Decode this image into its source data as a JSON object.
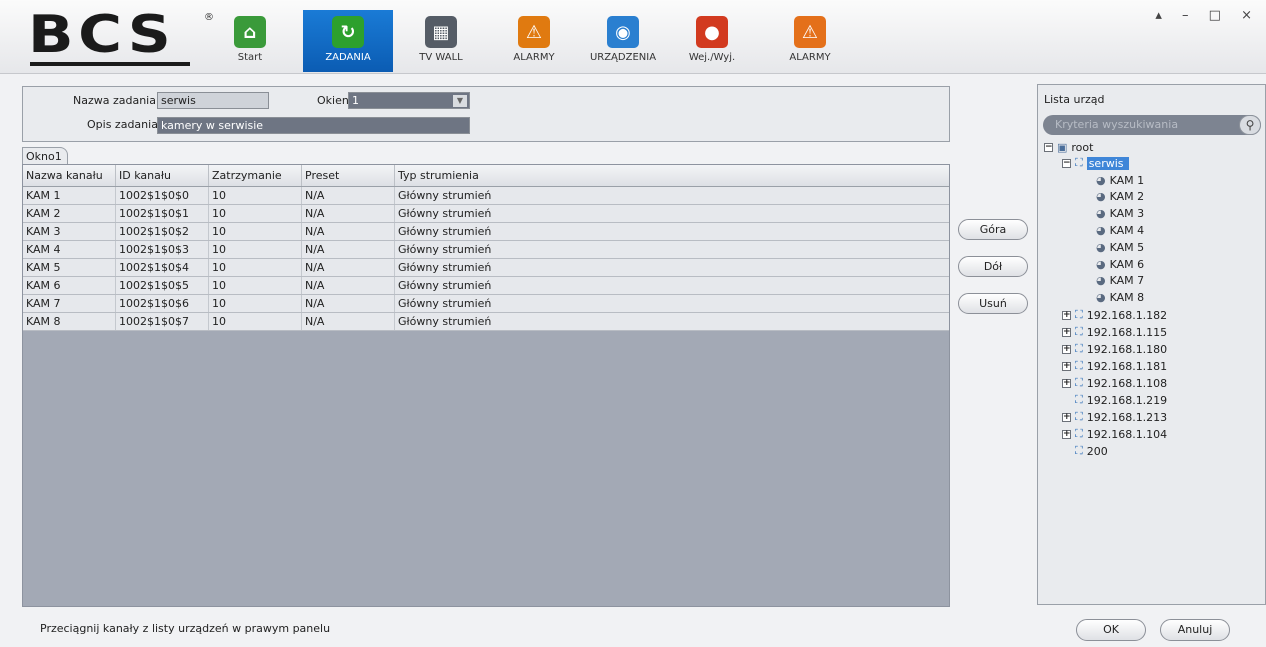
{
  "logo": {
    "text": "BCS",
    "reg": "®"
  },
  "nav": [
    {
      "label": "Start",
      "icon": "home-icon",
      "color": "#3a9a3a",
      "active": false
    },
    {
      "label": "ZADANIA",
      "icon": "tasks-icon",
      "color": "#2da02d",
      "active": true
    },
    {
      "label": "TV WALL",
      "icon": "tv-wall-icon",
      "color": "#555c66",
      "active": false
    },
    {
      "label": "ALARMY",
      "icon": "alarm-warning-icon",
      "color": "#e07a10",
      "active": false
    },
    {
      "label": "URZĄDZENIA",
      "icon": "device-icon",
      "color": "#2a7fd0",
      "active": false
    },
    {
      "label": "Wej./Wyj.",
      "icon": "siren-icon",
      "color": "#d23a1f",
      "active": false
    },
    {
      "label": "ALARMY",
      "icon": "alarm-icon",
      "color": "#e4701a",
      "active": false
    }
  ],
  "window_controls": "▴ – □ ×",
  "form": {
    "task_name_label": "Nazwa zadania",
    "task_name_value": "serwis",
    "windows_label": "Okien",
    "windows_value": "1",
    "task_desc_label": "Opis zadania",
    "task_desc_value": "kamery w serwisie"
  },
  "tab_label": "Okno1",
  "table": {
    "headers": [
      "Nazwa kanału",
      "ID kanału",
      "Zatrzymanie",
      "Preset",
      "Typ strumienia"
    ],
    "rows": [
      [
        "KAM 1",
        "1002$1$0$0",
        "10",
        "N/A",
        "Główny strumień"
      ],
      [
        "KAM 2",
        "1002$1$0$1",
        "10",
        "N/A",
        "Główny strumień"
      ],
      [
        "KAM 3",
        "1002$1$0$2",
        "10",
        "N/A",
        "Główny strumień"
      ],
      [
        "KAM 4",
        "1002$1$0$3",
        "10",
        "N/A",
        "Główny strumień"
      ],
      [
        "KAM 5",
        "1002$1$0$4",
        "10",
        "N/A",
        "Główny strumień"
      ],
      [
        "KAM 6",
        "1002$1$0$5",
        "10",
        "N/A",
        "Główny strumień"
      ],
      [
        "KAM 7",
        "1002$1$0$6",
        "10",
        "N/A",
        "Główny strumień"
      ],
      [
        "KAM 8",
        "1002$1$0$7",
        "10",
        "N/A",
        "Główny strumień"
      ]
    ]
  },
  "side_buttons": {
    "up": "Góra",
    "down": "Dół",
    "remove": "Usuń"
  },
  "footnote": "Przeciągnij kanały z listy urządzeń w prawym panelu",
  "device_panel": {
    "title": "Lista urząd",
    "search_placeholder": "Kryteria wyszukiwania",
    "root": "root",
    "group": "serwis",
    "cameras": [
      "KAM 1",
      "KAM 2",
      "KAM 3",
      "KAM 4",
      "KAM 5",
      "KAM 6",
      "KAM 7",
      "KAM 8"
    ],
    "devices": [
      {
        "label": "192.168.1.182",
        "expandable": true
      },
      {
        "label": "192.168.1.115",
        "expandable": true
      },
      {
        "label": "192.168.1.180",
        "expandable": true
      },
      {
        "label": "192.168.1.181",
        "expandable": true
      },
      {
        "label": "192.168.1.108",
        "expandable": true
      },
      {
        "label": "192.168.1.219",
        "expandable": false
      },
      {
        "label": "192.168.1.213",
        "expandable": true
      },
      {
        "label": "192.168.1.104",
        "expandable": true
      },
      {
        "label": "200",
        "expandable": false
      }
    ]
  },
  "dialog_buttons": {
    "ok": "OK",
    "cancel": "Anuluj"
  }
}
